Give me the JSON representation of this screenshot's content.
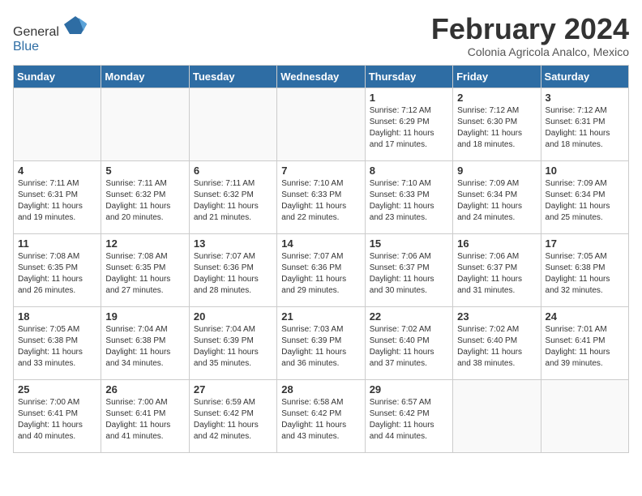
{
  "header": {
    "title": "February 2024",
    "subtitle": "Colonia Agricola Analco, Mexico",
    "logo_general": "General",
    "logo_blue": "Blue"
  },
  "days_of_week": [
    "Sunday",
    "Monday",
    "Tuesday",
    "Wednesday",
    "Thursday",
    "Friday",
    "Saturday"
  ],
  "weeks": [
    [
      {
        "day": "",
        "info": ""
      },
      {
        "day": "",
        "info": ""
      },
      {
        "day": "",
        "info": ""
      },
      {
        "day": "",
        "info": ""
      },
      {
        "day": "1",
        "info": "Sunrise: 7:12 AM\nSunset: 6:29 PM\nDaylight: 11 hours and 17 minutes."
      },
      {
        "day": "2",
        "info": "Sunrise: 7:12 AM\nSunset: 6:30 PM\nDaylight: 11 hours and 18 minutes."
      },
      {
        "day": "3",
        "info": "Sunrise: 7:12 AM\nSunset: 6:31 PM\nDaylight: 11 hours and 18 minutes."
      }
    ],
    [
      {
        "day": "4",
        "info": "Sunrise: 7:11 AM\nSunset: 6:31 PM\nDaylight: 11 hours and 19 minutes."
      },
      {
        "day": "5",
        "info": "Sunrise: 7:11 AM\nSunset: 6:32 PM\nDaylight: 11 hours and 20 minutes."
      },
      {
        "day": "6",
        "info": "Sunrise: 7:11 AM\nSunset: 6:32 PM\nDaylight: 11 hours and 21 minutes."
      },
      {
        "day": "7",
        "info": "Sunrise: 7:10 AM\nSunset: 6:33 PM\nDaylight: 11 hours and 22 minutes."
      },
      {
        "day": "8",
        "info": "Sunrise: 7:10 AM\nSunset: 6:33 PM\nDaylight: 11 hours and 23 minutes."
      },
      {
        "day": "9",
        "info": "Sunrise: 7:09 AM\nSunset: 6:34 PM\nDaylight: 11 hours and 24 minutes."
      },
      {
        "day": "10",
        "info": "Sunrise: 7:09 AM\nSunset: 6:34 PM\nDaylight: 11 hours and 25 minutes."
      }
    ],
    [
      {
        "day": "11",
        "info": "Sunrise: 7:08 AM\nSunset: 6:35 PM\nDaylight: 11 hours and 26 minutes."
      },
      {
        "day": "12",
        "info": "Sunrise: 7:08 AM\nSunset: 6:35 PM\nDaylight: 11 hours and 27 minutes."
      },
      {
        "day": "13",
        "info": "Sunrise: 7:07 AM\nSunset: 6:36 PM\nDaylight: 11 hours and 28 minutes."
      },
      {
        "day": "14",
        "info": "Sunrise: 7:07 AM\nSunset: 6:36 PM\nDaylight: 11 hours and 29 minutes."
      },
      {
        "day": "15",
        "info": "Sunrise: 7:06 AM\nSunset: 6:37 PM\nDaylight: 11 hours and 30 minutes."
      },
      {
        "day": "16",
        "info": "Sunrise: 7:06 AM\nSunset: 6:37 PM\nDaylight: 11 hours and 31 minutes."
      },
      {
        "day": "17",
        "info": "Sunrise: 7:05 AM\nSunset: 6:38 PM\nDaylight: 11 hours and 32 minutes."
      }
    ],
    [
      {
        "day": "18",
        "info": "Sunrise: 7:05 AM\nSunset: 6:38 PM\nDaylight: 11 hours and 33 minutes."
      },
      {
        "day": "19",
        "info": "Sunrise: 7:04 AM\nSunset: 6:38 PM\nDaylight: 11 hours and 34 minutes."
      },
      {
        "day": "20",
        "info": "Sunrise: 7:04 AM\nSunset: 6:39 PM\nDaylight: 11 hours and 35 minutes."
      },
      {
        "day": "21",
        "info": "Sunrise: 7:03 AM\nSunset: 6:39 PM\nDaylight: 11 hours and 36 minutes."
      },
      {
        "day": "22",
        "info": "Sunrise: 7:02 AM\nSunset: 6:40 PM\nDaylight: 11 hours and 37 minutes."
      },
      {
        "day": "23",
        "info": "Sunrise: 7:02 AM\nSunset: 6:40 PM\nDaylight: 11 hours and 38 minutes."
      },
      {
        "day": "24",
        "info": "Sunrise: 7:01 AM\nSunset: 6:41 PM\nDaylight: 11 hours and 39 minutes."
      }
    ],
    [
      {
        "day": "25",
        "info": "Sunrise: 7:00 AM\nSunset: 6:41 PM\nDaylight: 11 hours and 40 minutes."
      },
      {
        "day": "26",
        "info": "Sunrise: 7:00 AM\nSunset: 6:41 PM\nDaylight: 11 hours and 41 minutes."
      },
      {
        "day": "27",
        "info": "Sunrise: 6:59 AM\nSunset: 6:42 PM\nDaylight: 11 hours and 42 minutes."
      },
      {
        "day": "28",
        "info": "Sunrise: 6:58 AM\nSunset: 6:42 PM\nDaylight: 11 hours and 43 minutes."
      },
      {
        "day": "29",
        "info": "Sunrise: 6:57 AM\nSunset: 6:42 PM\nDaylight: 11 hours and 44 minutes."
      },
      {
        "day": "",
        "info": ""
      },
      {
        "day": "",
        "info": ""
      }
    ]
  ]
}
